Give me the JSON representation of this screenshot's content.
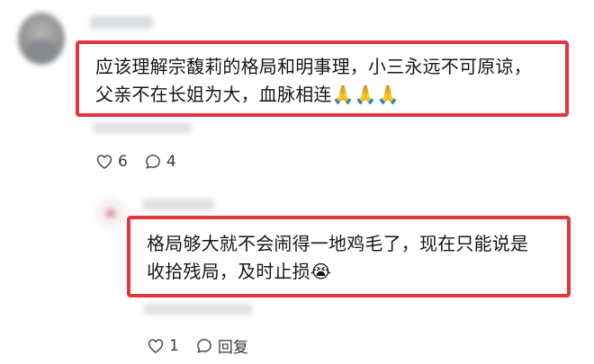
{
  "comments": [
    {
      "text_line1": "应该理解宗馥莉的格局和明事理，小三永远不可原谅，",
      "text_line2": "父亲不在长姐为大，血脉相连🙏🙏🙏",
      "like_count": "6",
      "reply_count": "4",
      "icons": {
        "like": "heart-outline-icon",
        "reply": "speech-bubble-icon"
      }
    },
    {
      "text_line1": "格局够大就不会闹得一地鸡毛了，现在只能说是",
      "text_line2": "收拾残局，及时止损😭",
      "like_count": "1",
      "reply_label": "回复",
      "icons": {
        "like": "heart-outline-icon",
        "reply": "speech-bubble-icon"
      }
    }
  ],
  "colors": {
    "highlight_border": "#e3353f"
  }
}
